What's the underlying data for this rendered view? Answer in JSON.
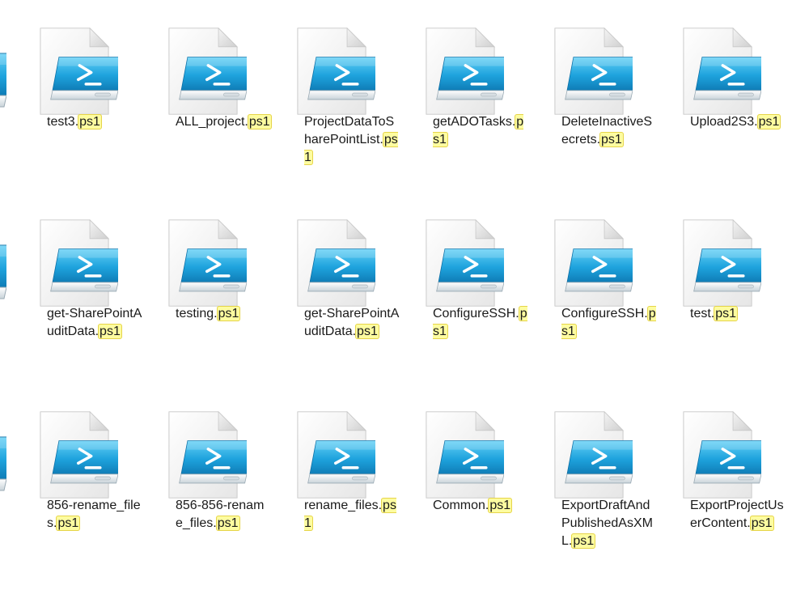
{
  "files": [
    {
      "base": "test3.",
      "ext": "ps1"
    },
    {
      "base": "ALL_project.",
      "ext": "ps1"
    },
    {
      "base": "ProjectDataToSharePointList.",
      "ext": "ps1"
    },
    {
      "base": "getADOTasks.",
      "ext": "ps1"
    },
    {
      "base": "DeleteInactiveSecrets.",
      "ext": "ps1"
    },
    {
      "base": "Upload2S3.",
      "ext": "ps1"
    },
    {
      "base": "get-SharePointAuditData.",
      "ext": "ps1"
    },
    {
      "base": "testing.",
      "ext": "ps1"
    },
    {
      "base": "get-SharePointAuditData.",
      "ext": "ps1"
    },
    {
      "base": "ConfigureSSH.",
      "ext": "ps1"
    },
    {
      "base": "ConfigureSSH.",
      "ext": "ps1"
    },
    {
      "base": "test.",
      "ext": "ps1"
    },
    {
      "base": "856-rename_files.",
      "ext": "ps1"
    },
    {
      "base": "856-856-rename_files.",
      "ext": "ps1"
    },
    {
      "base": "rename_files.",
      "ext": "ps1"
    },
    {
      "base": "Common.",
      "ext": "ps1"
    },
    {
      "base": "ExportDraftAndPublishedAsXML.",
      "ext": "ps1"
    },
    {
      "base": "ExportProjectUserContent.",
      "ext": "ps1"
    }
  ],
  "icon": "powershell-script-file-icon",
  "colors": {
    "highlight_bg": "#fdfca0",
    "highlight_border": "#e6d44a",
    "icon_blue": "#1e9ad6"
  }
}
